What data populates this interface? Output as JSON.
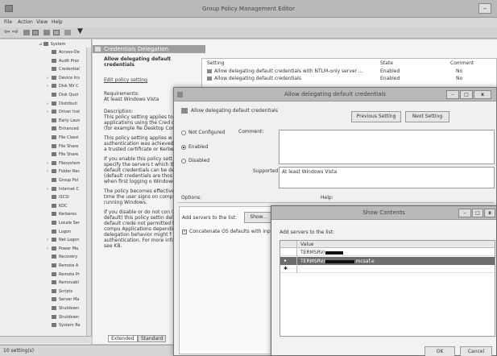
{
  "main_window": {
    "title": "Group Policy Management Editor",
    "menu": [
      "File",
      "Action",
      "View",
      "Help"
    ],
    "status": "10 setting(s)"
  },
  "tree": {
    "root": "System",
    "items": [
      "Access-De",
      "Audit Proc",
      "Credential",
      "Device Ins",
      "Disk NV C",
      "Disk Quot",
      "Distributi",
      "Driver Inst",
      "Early Laun",
      "Enhanced",
      "File Classi",
      "File Share",
      "File Share",
      "Filesystem",
      "Folder Rec",
      "Group Pol",
      "Internet C",
      "iSCSI",
      "KDC",
      "Kerberos",
      "Locale Ser",
      "Logon",
      "Net Logon",
      "Power Ma",
      "Recovery",
      "Remote A",
      "Remote Pr",
      "Removabl",
      "Scripts",
      "Server Ma",
      "Shutdown",
      "Shutdown",
      "System Re"
    ]
  },
  "details": {
    "header": "Credentials Delegation",
    "selected_title": "Allow delegating default credentials",
    "edit_link": "Edit policy setting",
    "requirements_label": "Requirements:",
    "requirements_value": "At least Windows Vista",
    "description": [
      "Description:\nThis policy setting applies to applications using the Cred component (for example Re Desktop Connection).",
      "This policy setting applies w server authentication was achieved by using a trusted certificate or Kerberos.",
      "If you enable this policy sett you can specify the servers t which the user's default credentials can be delegate (default credentials are thos you use when first logging o Windows).",
      "The policy becomes effective next time the user signs on computer running Windows.",
      "If you disable or do not con (by default) this policy settin delegation of default crede not permitted to any compu Applications depending upo delegation behavior might f authentication. For more information, see KB."
    ],
    "tabs": [
      "Extended",
      "Standard"
    ],
    "columns": [
      "Setting",
      "State",
      "Comment"
    ],
    "rows": [
      {
        "setting": "Allow delegating default credentials with NTLM-only server ...",
        "state": "Enabled",
        "comment": "No"
      },
      {
        "setting": "Allow delegating default credentials",
        "state": "Enabled",
        "comment": "No"
      }
    ]
  },
  "policy_dialog": {
    "title": "Allow delegating default credentials",
    "subtitle": "Allow delegating default credentials",
    "previous_button": "Previous Setting",
    "next_button": "Next Setting",
    "options": [
      "Not Configured",
      "Enabled",
      "Disabled"
    ],
    "selected_option": "Enabled",
    "comment_label": "Comment:",
    "supported_label": "Supported on:",
    "supported_value": "At least Windows Vista",
    "options_label": "Options:",
    "help_label": "Help:",
    "add_servers_label": "Add servers to the list:",
    "show_button": "Show...",
    "concatenate_label": "Concatenate OS defaults with inp"
  },
  "show_contents": {
    "title": "Show Contents",
    "label": "Add servers to the list:",
    "column": "Value",
    "rows": [
      "TERMSRV/",
      "TERMSRV/",
      ""
    ],
    "row_suffix": ".mcsaf.e",
    "ok_button": "OK",
    "cancel_button": "Cancel"
  },
  "colors": {
    "selected_row": "#6d6d6d",
    "header_band": "#9e9e9e",
    "title_bar": "#b9b9b9"
  }
}
